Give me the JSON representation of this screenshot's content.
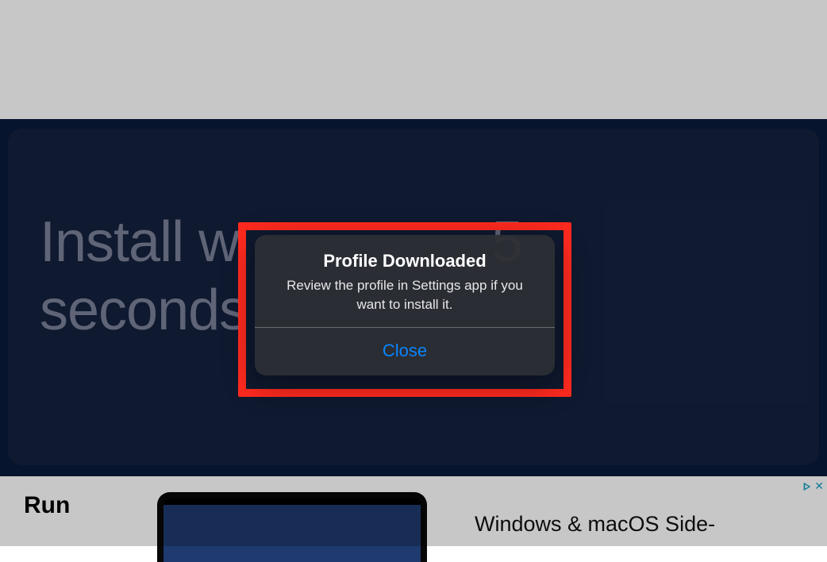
{
  "hero": {
    "headline_line1": "Install w",
    "headline_mid": "5",
    "headline_line2": "seconds"
  },
  "alert": {
    "title": "Profile Downloaded",
    "message": "Review the profile in Settings app if you want to install it.",
    "close_label": "Close"
  },
  "ad": {
    "left_title": "Run",
    "right_title": "Windows & macOS Side-",
    "info_icon": "info-icon",
    "close_glyph": "✕"
  }
}
